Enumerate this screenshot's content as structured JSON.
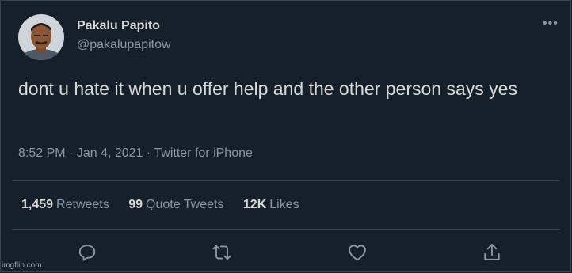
{
  "tweet": {
    "display_name": "Pakalu Papito",
    "handle": "@pakalupapitow",
    "more_icon": "more-horizontal-icon",
    "text": "dont u hate it when u offer help and the other person says yes",
    "time": "8:52 PM",
    "date": "Jan 4, 2021",
    "source": "Twitter for iPhone",
    "separator": "·"
  },
  "stats": {
    "retweets": {
      "count": "1,459",
      "label": "Retweets"
    },
    "quote_tweets": {
      "count": "99",
      "label": "Quote Tweets"
    },
    "likes": {
      "count": "12K",
      "label": "Likes"
    }
  },
  "actions": [
    {
      "icon": "reply-icon"
    },
    {
      "icon": "retweet-icon"
    },
    {
      "icon": "like-icon"
    },
    {
      "icon": "share-icon"
    }
  ],
  "colors": {
    "background": "#15202b",
    "primary_text": "#d9d9d9",
    "secondary_text": "#8b98a5",
    "border": "#38444d"
  },
  "watermark": "imgflip.com"
}
